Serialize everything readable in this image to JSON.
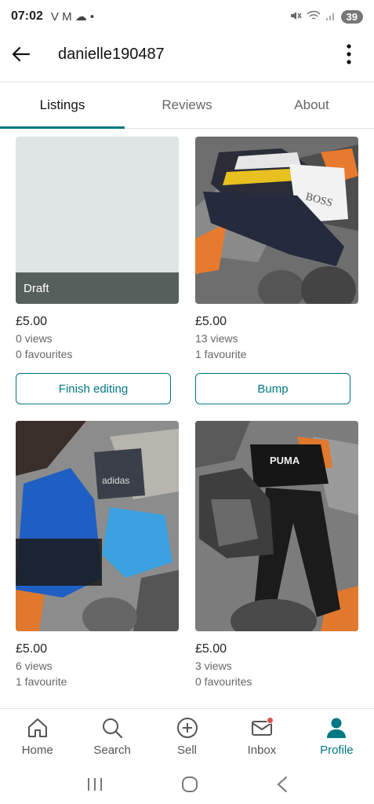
{
  "status_bar": {
    "time": "07:02",
    "left_icons": "V M ☁ •",
    "battery": "39"
  },
  "header": {
    "username": "danielle190487"
  },
  "tabs": [
    {
      "label": "Listings"
    },
    {
      "label": "Reviews"
    },
    {
      "label": "About"
    }
  ],
  "listings": [
    {
      "badge": "Draft",
      "price": "£5.00",
      "views": "0 views",
      "favourites": "0 favourites",
      "button": "Finish editing"
    },
    {
      "price": "£5.00",
      "views": "13 views",
      "favourites": "1 favourite",
      "button": "Bump"
    },
    {
      "price": "£5.00",
      "views": "6 views",
      "favourites": "1 favourite"
    },
    {
      "price": "£5.00",
      "views": "3 views",
      "favourites": "0 favourites"
    }
  ],
  "bottom_nav": [
    {
      "label": "Home",
      "icon": "home-icon"
    },
    {
      "label": "Search",
      "icon": "search-icon"
    },
    {
      "label": "Sell",
      "icon": "plus-circle-icon"
    },
    {
      "label": "Inbox",
      "icon": "mail-icon"
    },
    {
      "label": "Profile",
      "icon": "profile-icon"
    }
  ],
  "colors": {
    "accent": "#007782",
    "notification": "#d9534f",
    "draft_overlay": "#575f5c"
  }
}
